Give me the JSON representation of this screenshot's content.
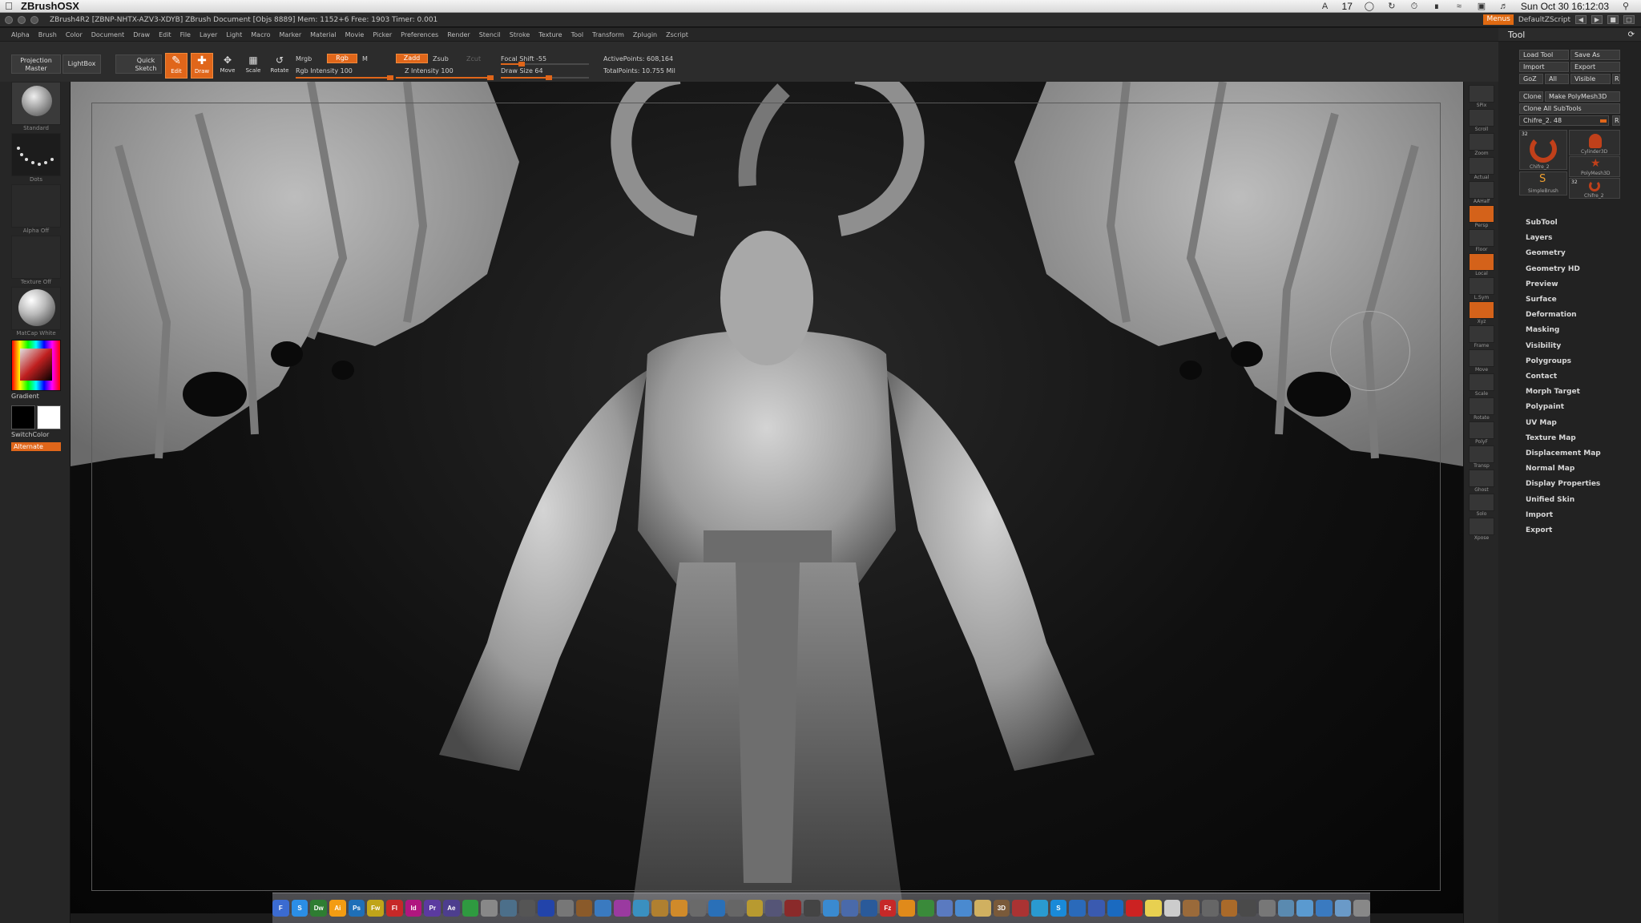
{
  "macbar": {
    "app_name": "ZBrushOSX",
    "status_num": "17",
    "clock": "Sun Oct 30  16:12:03"
  },
  "titlebar": {
    "title": "ZBrush4R2 [ZBNP-NHTX-AZV3-XDYB]   ZBrush Document   [Objs 8889] Mem: 1152+6 Free: 1903 Timer: 0.001",
    "menus_label": "Menus",
    "script_label": "DefaultZScript"
  },
  "mainmenu": [
    "Alpha",
    "Brush",
    "Color",
    "Document",
    "Draw",
    "Edit",
    "File",
    "Layer",
    "Light",
    "Macro",
    "Marker",
    "Material",
    "Movie",
    "Picker",
    "Preferences",
    "Render",
    "Stencil",
    "Stroke",
    "Texture",
    "Tool",
    "Transform",
    "Zplugin",
    "Zscript"
  ],
  "shelf": {
    "projection_master": "Projection Master",
    "lightbox": "LightBox",
    "quick_sketch": "Quick Sketch",
    "edit": "Edit",
    "draw": "Draw",
    "move": "Move",
    "scale": "Scale",
    "rotate": "Rotate",
    "mrgb": "Mrgb",
    "rgb": "Rgb",
    "m": "M",
    "zadd": "Zadd",
    "zsub": "Zsub",
    "zcut": "Zcut",
    "rgb_intensity": "Rgb Intensity 100",
    "z_intensity": "Z Intensity 100",
    "focal_shift": "Focal Shift -55",
    "draw_size": "Draw Size 64",
    "active_points": "ActivePoints: 608,164",
    "total_points": "TotalPoints: 10.755 Mil"
  },
  "leftshelf": {
    "brush": "Standard",
    "stroke": "Dots",
    "alpha": "Alpha Off",
    "texture": "Texture Off",
    "material": "MatCap White",
    "gradient": "Gradient",
    "switchcolor": "SwitchColor",
    "alternate": "Alternate"
  },
  "rightshelf": [
    "SPix",
    "Scroll",
    "Zoom",
    "Actual",
    "AAHalf",
    "Persp",
    "Floor",
    "Local",
    "L.Sym",
    "Xyz",
    "Frame",
    "Move",
    "Scale",
    "Rotate",
    "PolyF",
    "Transp",
    "Ghost",
    "Solo",
    "Xpose"
  ],
  "tool": {
    "header": "Tool",
    "load_tool": "Load Tool",
    "save_as": "Save As",
    "import": "Import",
    "export": "Export",
    "goz": "GoZ",
    "all": "All",
    "visible": "Visible",
    "r": "R",
    "clone": "Clone",
    "make_polymesh": "Make PolyMesh3D",
    "clone_all": "Clone All SubTools",
    "current_tool": "Chifre_2. 48",
    "thumb_count": "32",
    "thumbs": [
      "Chifre_2",
      "Cylinder3D",
      "PolyMesh3D",
      "SimpleBrush",
      "Chifre_2"
    ],
    "sections": [
      "SubTool",
      "Layers",
      "Geometry",
      "Geometry HD",
      "Preview",
      "Surface",
      "Deformation",
      "Masking",
      "Visibility",
      "Polygroups",
      "Contact",
      "Morph Target",
      "Polypaint",
      "UV Map",
      "Texture Map",
      "Displacement Map",
      "Normal Map",
      "Display Properties",
      "Unified Skin",
      "Import",
      "Export"
    ]
  },
  "dock": [
    {
      "label": "F",
      "color": "#3b6bd1"
    },
    {
      "label": "S",
      "color": "#2b8ee6"
    },
    {
      "label": "Dw",
      "color": "#2e7d32"
    },
    {
      "label": "Ai",
      "color": "#f39c12"
    },
    {
      "label": "Ps",
      "color": "#1e6fb8"
    },
    {
      "label": "Fw",
      "color": "#c0a419"
    },
    {
      "label": "Fl",
      "color": "#c62828"
    },
    {
      "label": "Id",
      "color": "#b0167f"
    },
    {
      "label": "Pr",
      "color": "#5b3aa0"
    },
    {
      "label": "Ae",
      "color": "#4d3e8e"
    },
    {
      "label": "",
      "color": "#2f9a40"
    },
    {
      "label": "",
      "color": "#888888"
    },
    {
      "label": "",
      "color": "#4c6f8a"
    },
    {
      "label": "",
      "color": "#555555"
    },
    {
      "label": "",
      "color": "#2244aa"
    },
    {
      "label": "",
      "color": "#777777"
    },
    {
      "label": "",
      "color": "#8a5a2a"
    },
    {
      "label": "",
      "color": "#3a7ac0"
    },
    {
      "label": "",
      "color": "#9a3aa0"
    },
    {
      "label": "",
      "color": "#3a90c0"
    },
    {
      "label": "",
      "color": "#b08030"
    },
    {
      "label": "",
      "color": "#d08a2a"
    },
    {
      "label": "",
      "color": "#6a6a6a"
    },
    {
      "label": "",
      "color": "#2a70b8"
    },
    {
      "label": "",
      "color": "#666666"
    },
    {
      "label": "",
      "color": "#b89a30"
    },
    {
      "label": "",
      "color": "#555577"
    },
    {
      "label": "",
      "color": "#8a2a2a"
    },
    {
      "label": "",
      "color": "#444444"
    },
    {
      "label": "",
      "color": "#3a8ad0"
    },
    {
      "label": "",
      "color": "#4a6aaa"
    },
    {
      "label": "",
      "color": "#2a5a9a"
    },
    {
      "label": "Fz",
      "color": "#c62828"
    },
    {
      "label": "",
      "color": "#e08a1a"
    },
    {
      "label": "",
      "color": "#3a8a3a"
    },
    {
      "label": "",
      "color": "#5a7ac0"
    },
    {
      "label": "",
      "color": "#4a8ad0"
    },
    {
      "label": "",
      "color": "#d0b060"
    },
    {
      "label": "3D",
      "color": "#7a5a3a"
    },
    {
      "label": "",
      "color": "#aa3333"
    },
    {
      "label": "",
      "color": "#2a9ad0"
    },
    {
      "label": "S",
      "color": "#1a8ad8"
    },
    {
      "label": "",
      "color": "#2a6aba"
    },
    {
      "label": "",
      "color": "#3a5ab0"
    },
    {
      "label": "",
      "color": "#1a6ac0"
    },
    {
      "label": "",
      "color": "#cc2222"
    },
    {
      "label": "",
      "color": "#e8d050"
    },
    {
      "label": "",
      "color": "#cccccc"
    },
    {
      "label": "",
      "color": "#9a6a3a"
    },
    {
      "label": "",
      "color": "#666666"
    },
    {
      "label": "",
      "color": "#aa6a2a"
    },
    {
      "label": "",
      "color": "#4a4a4a"
    },
    {
      "label": "",
      "color": "#777777"
    },
    {
      "label": "",
      "color": "#5a8ab0"
    },
    {
      "label": "",
      "color": "#5a9ad0"
    },
    {
      "label": "",
      "color": "#3a7ac0"
    },
    {
      "label": "",
      "color": "#6a9ac8"
    },
    {
      "label": "",
      "color": "#888888"
    }
  ]
}
